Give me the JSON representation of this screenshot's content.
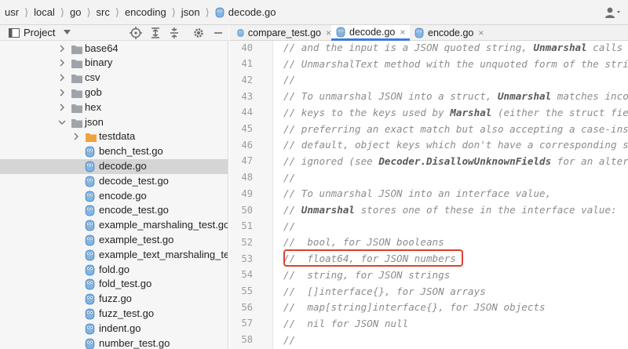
{
  "breadcrumb": [
    "usr",
    "local",
    "go",
    "src",
    "encoding",
    "json",
    "decode.go"
  ],
  "project": {
    "label": "Project"
  },
  "tree": [
    {
      "name": "base64",
      "type": "folder",
      "expanded": false,
      "depth": 1
    },
    {
      "name": "binary",
      "type": "folder",
      "expanded": false,
      "depth": 1
    },
    {
      "name": "csv",
      "type": "folder",
      "expanded": false,
      "depth": 1
    },
    {
      "name": "gob",
      "type": "folder",
      "expanded": false,
      "depth": 1
    },
    {
      "name": "hex",
      "type": "folder",
      "expanded": false,
      "depth": 1
    },
    {
      "name": "json",
      "type": "folder",
      "expanded": true,
      "depth": 1
    },
    {
      "name": "testdata",
      "type": "folder-orange",
      "expanded": false,
      "depth": 2
    },
    {
      "name": "bench_test.go",
      "type": "gofile",
      "depth": 2
    },
    {
      "name": "decode.go",
      "type": "gofile",
      "depth": 2,
      "selected": true
    },
    {
      "name": "decode_test.go",
      "type": "gofile",
      "depth": 2
    },
    {
      "name": "encode.go",
      "type": "gofile",
      "depth": 2
    },
    {
      "name": "encode_test.go",
      "type": "gofile",
      "depth": 2
    },
    {
      "name": "example_marshaling_test.go",
      "type": "gofile",
      "depth": 2
    },
    {
      "name": "example_test.go",
      "type": "gofile",
      "depth": 2
    },
    {
      "name": "example_text_marshaling_te",
      "type": "gofile",
      "depth": 2
    },
    {
      "name": "fold.go",
      "type": "gofile",
      "depth": 2
    },
    {
      "name": "fold_test.go",
      "type": "gofile",
      "depth": 2
    },
    {
      "name": "fuzz.go",
      "type": "gofile",
      "depth": 2
    },
    {
      "name": "fuzz_test.go",
      "type": "gofile",
      "depth": 2
    },
    {
      "name": "indent.go",
      "type": "gofile",
      "depth": 2
    },
    {
      "name": "number_test.go",
      "type": "gofile",
      "depth": 2
    }
  ],
  "tabs": [
    {
      "label": "compare_test.go",
      "active": false
    },
    {
      "label": "decode.go",
      "active": true
    },
    {
      "label": "encode.go",
      "active": false
    }
  ],
  "code": [
    {
      "n": "40",
      "t": "// and the input is a JSON quoted string, **Unmarshal** calls"
    },
    {
      "n": "41",
      "t": "// UnmarshalText method with the unquoted form of the stri"
    },
    {
      "n": "42",
      "t": "//"
    },
    {
      "n": "43",
      "t": "// To unmarshal JSON into a struct, **Unmarshal** matches inco"
    },
    {
      "n": "44",
      "t": "// keys to the keys used by **Marshal** (either the struct fie"
    },
    {
      "n": "45",
      "t": "// preferring an exact match but also accepting a case-ins"
    },
    {
      "n": "46",
      "t": "// default, object keys which don't have a corresponding s"
    },
    {
      "n": "47",
      "t": "// ignored (see **Decoder.DisallowUnknownFields** for an alter"
    },
    {
      "n": "48",
      "t": "//"
    },
    {
      "n": "49",
      "t": "// To unmarshal JSON into an interface value,"
    },
    {
      "n": "50",
      "t": "// **Unmarshal** stores one of these in the interface value:"
    },
    {
      "n": "51",
      "t": "//"
    },
    {
      "n": "52",
      "t": "//  bool, for JSON booleans"
    },
    {
      "n": "53",
      "t": "//  float64, for JSON numbers"
    },
    {
      "n": "54",
      "t": "//  string, for JSON strings"
    },
    {
      "n": "55",
      "t": "//  []interface{}, for JSON arrays"
    },
    {
      "n": "56",
      "t": "//  map[string]interface{}, for JSON objects"
    },
    {
      "n": "57",
      "t": "//  nil for JSON null"
    },
    {
      "n": "58",
      "t": "//"
    }
  ],
  "colors": {
    "accent": "#3d7bd9",
    "highlight": "#e0402f",
    "selected_row": "#d5d5d5"
  }
}
